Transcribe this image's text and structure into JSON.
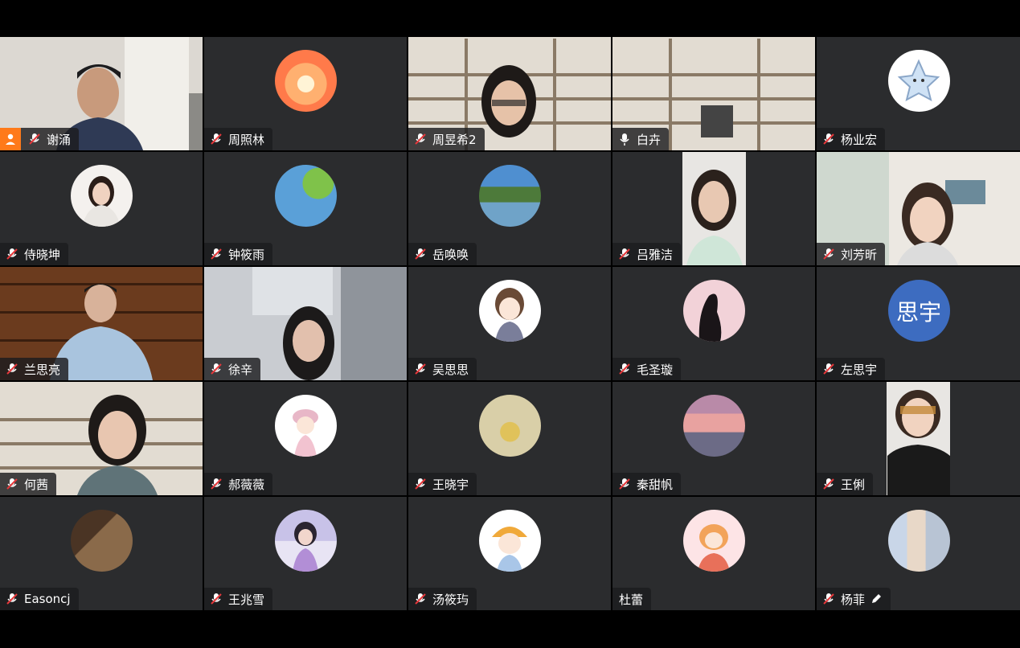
{
  "participants": [
    {
      "name": "谢涌",
      "mic": "muted",
      "host": true,
      "media": "video",
      "bg": "room-light"
    },
    {
      "name": "周照林",
      "mic": "muted",
      "media": "avatar",
      "avatar": "sunset-avatar"
    },
    {
      "name": "周昱希2",
      "mic": "muted",
      "media": "video",
      "bg": "bookshelf"
    },
    {
      "name": "白卉",
      "mic": "on",
      "media": "video",
      "bg": "bookshelf"
    },
    {
      "name": "杨业宏",
      "mic": "muted",
      "media": "avatar",
      "avatar": "cartoon-star-avatar"
    },
    {
      "name": "侍晓坤",
      "mic": "muted",
      "media": "avatar",
      "avatar": "portrait-avatar"
    },
    {
      "name": "钟筱雨",
      "mic": "muted",
      "media": "avatar",
      "avatar": "green-leaves-avatar"
    },
    {
      "name": "岳唤唤",
      "mic": "muted",
      "media": "avatar",
      "avatar": "river-landscape-avatar"
    },
    {
      "name": "吕雅洁",
      "mic": "muted",
      "media": "video-portrait",
      "bg": "white-wall"
    },
    {
      "name": "刘芳昕",
      "mic": "muted",
      "media": "video",
      "bg": "living-room"
    },
    {
      "name": "兰思亮",
      "mic": "muted",
      "media": "video",
      "bg": "library"
    },
    {
      "name": "徐辛",
      "mic": "muted",
      "media": "video",
      "bg": "office"
    },
    {
      "name": "吴思思",
      "mic": "muted",
      "media": "avatar",
      "avatar": "cartoon-girl-avatar"
    },
    {
      "name": "毛圣璇",
      "mic": "muted",
      "media": "avatar",
      "avatar": "silhouette-avatar"
    },
    {
      "name": "左思宇",
      "mic": "muted",
      "media": "avatar-text",
      "avatar_text": "思宇",
      "avatar_color": "#3d6cc0"
    },
    {
      "name": "何茜",
      "mic": "muted",
      "media": "video",
      "bg": "bookshelf"
    },
    {
      "name": "郝薇薇",
      "mic": "muted",
      "media": "avatar",
      "avatar": "cartoon-fishing-avatar"
    },
    {
      "name": "王晓宇",
      "mic": "muted",
      "media": "avatar",
      "avatar": "ginkgo-leaf-avatar"
    },
    {
      "name": "秦甜帆",
      "mic": "muted",
      "media": "avatar",
      "avatar": "pink-sky-avatar"
    },
    {
      "name": "王俐",
      "mic": "muted",
      "media": "video-portrait",
      "bg": "white-wall"
    },
    {
      "name": "Easoncj",
      "mic": "muted",
      "media": "avatar",
      "avatar": "couple-photo-avatar"
    },
    {
      "name": "王兆雪",
      "mic": "muted",
      "media": "avatar",
      "avatar": "snow-girl-avatar"
    },
    {
      "name": "汤筱玙",
      "mic": "muted",
      "media": "avatar",
      "avatar": "cartoon-hat-avatar"
    },
    {
      "name": "杜蕾",
      "mic": "none",
      "media": "avatar",
      "avatar": "cartoon-tiger-avatar"
    },
    {
      "name": "杨菲",
      "mic": "muted",
      "media": "avatar",
      "avatar": "building-photo-avatar",
      "editing": true
    }
  ],
  "colors": {
    "tile": "#2b2c2e",
    "host_badge": "#ff7a1a",
    "mute_red": "#e5383b",
    "nametag_bg": "#1c1c1e"
  }
}
